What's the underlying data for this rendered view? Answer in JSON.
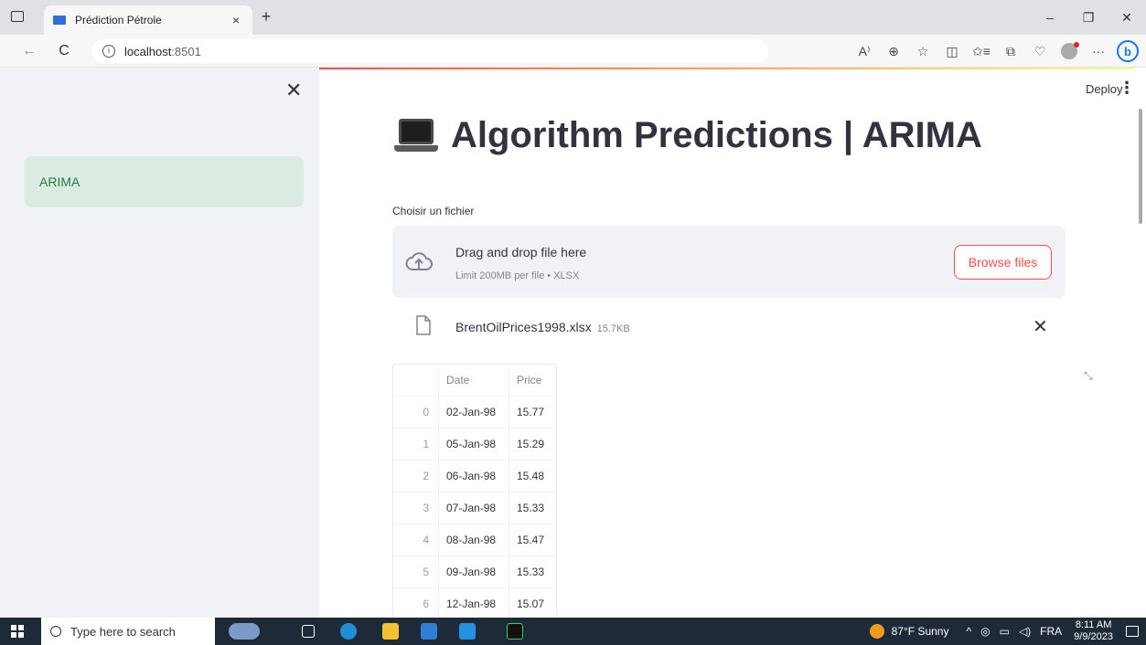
{
  "browser": {
    "tab_title": "Prédiction Pétrole",
    "tab_close": "×",
    "new_tab": "+",
    "url_host": "localhost",
    "url_port": ":8501",
    "read_aloud": "A⁾",
    "zoom": "⊕",
    "favorite": "☆",
    "split": "◫",
    "favorites": "✩≡",
    "collections": "⧉",
    "heart": "♡",
    "more": "···",
    "bing": "b",
    "minimize": "–",
    "restore": "❐",
    "close": "✕",
    "back": "←",
    "refresh": "C"
  },
  "sidebar": {
    "close_glyph": "✕",
    "items": [
      {
        "label": "ARIMA"
      }
    ]
  },
  "header": {
    "deploy_label": "Deploy",
    "menu_glyph": "⋮"
  },
  "main": {
    "title": "Algorithm Predictions | ARIMA",
    "uploader": {
      "label": "Choisir un fichier",
      "drag_text": "Drag and drop file here",
      "limit_text": "Limit 200MB per file • XLSX",
      "browse_label": "Browse files"
    },
    "uploaded_file": {
      "name": "BrentOilPrices1998.xlsx",
      "size": "15.7KB",
      "remove_glyph": "✕"
    },
    "table": {
      "columns": [
        "",
        "Date",
        "Price"
      ],
      "rows": [
        {
          "idx": "0",
          "date": "02-Jan-98",
          "price": "15.77"
        },
        {
          "idx": "1",
          "date": "05-Jan-98",
          "price": "15.29"
        },
        {
          "idx": "2",
          "date": "06-Jan-98",
          "price": "15.48"
        },
        {
          "idx": "3",
          "date": "07-Jan-98",
          "price": "15.33"
        },
        {
          "idx": "4",
          "date": "08-Jan-98",
          "price": "15.47"
        },
        {
          "idx": "5",
          "date": "09-Jan-98",
          "price": "15.33"
        },
        {
          "idx": "6",
          "date": "12-Jan-98",
          "price": "15.07"
        }
      ]
    }
  },
  "taskbar": {
    "search_placeholder": "Type here to search",
    "weather": "87°F  Sunny",
    "language": "FRA",
    "time": "8:11 AM",
    "date": "9/9/2023"
  },
  "colors": {
    "accent": "#ff4b4b",
    "sidebar_bg": "#f0f2f6",
    "sidebar_active_bg": "#dbebe1",
    "sidebar_active_text": "#1c7d44"
  }
}
